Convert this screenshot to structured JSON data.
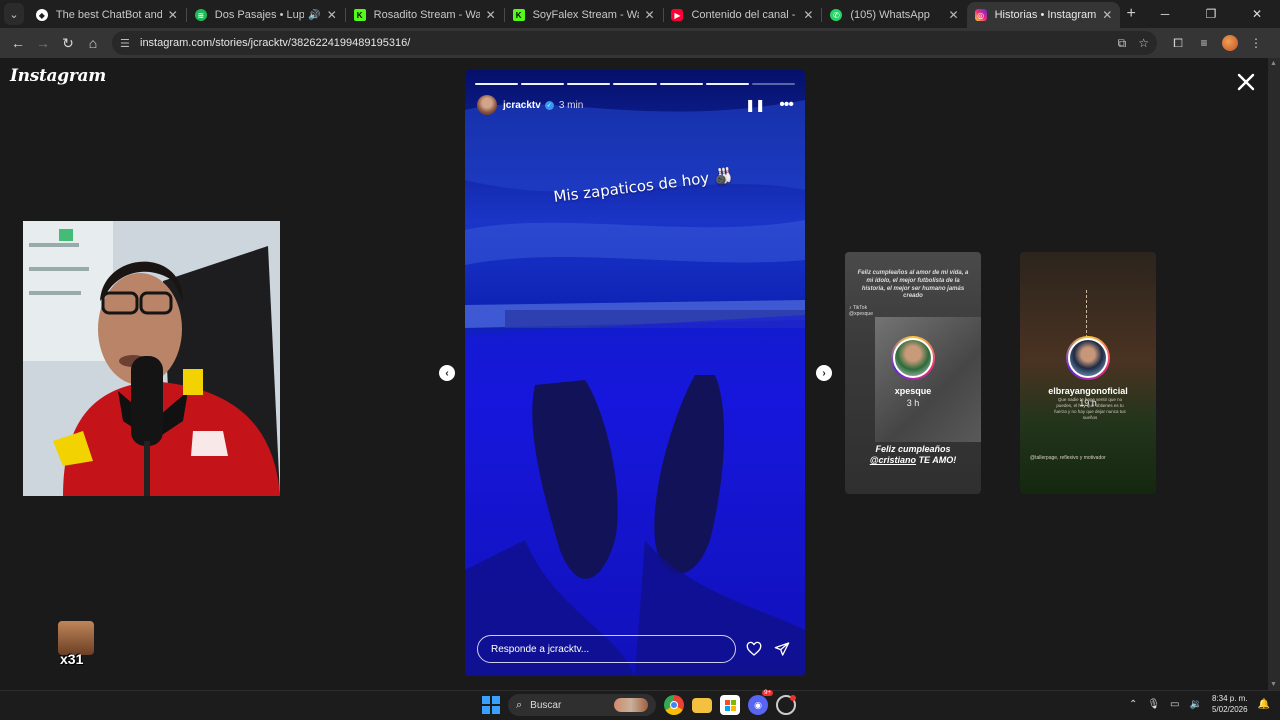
{
  "browser": {
    "tabs": [
      {
        "title": "The best ChatBot and Widgets",
        "favicon": "chatbot-icon",
        "color": "#ffffff",
        "active": false
      },
      {
        "title": "Dos Pasajes • Lupe Y Polo",
        "favicon": "spotify-icon",
        "color": "#1db954",
        "active": false,
        "audio": true
      },
      {
        "title": "Rosadito Stream - Watch Live o",
        "favicon": "kick-icon",
        "color": "#53fc18",
        "active": false
      },
      {
        "title": "SoyFalex Stream - Watch Live o",
        "favicon": "kick-icon",
        "color": "#53fc18",
        "active": false
      },
      {
        "title": "Contenido del canal - YouTube",
        "favicon": "youtube-icon",
        "color": "#ff0033",
        "active": false
      },
      {
        "title": "(105) WhatsApp",
        "favicon": "whatsapp-icon",
        "color": "#25d366",
        "active": false
      },
      {
        "title": "Historias • Instagram",
        "favicon": "instagram-icon",
        "color": "#e1306c",
        "active": true
      }
    ],
    "new_tab_label": "+",
    "url": "instagram.com/stories/jcracktv/3826224199489195316/"
  },
  "instagram": {
    "logo": "Instagram",
    "story": {
      "username": "jcracktv",
      "time": "3 min",
      "caption": "Mis zapaticos de hoy 🎳",
      "reply_placeholder": "Responde a jcracktv...",
      "segments_total": 7,
      "segments_done": 6
    },
    "next_stories": [
      {
        "username": "xpesque",
        "time": "3 h",
        "quote": "Feliz cumpleaños al amor de mi vida, a mi ídolo, el mejor futbolista de la historia, el mejor ser humano jamás creado",
        "watermark": "TikTok",
        "watermark_handle": "@xpesque",
        "bottom_line1": "Feliz cumpleaños",
        "bottom_mention": "@cristiano",
        "bottom_line2_rest": "TE AMO!"
      },
      {
        "username": "elbrayangonoficial",
        "time": "19 h",
        "small_text": "Que nadie te haga sentir que no puedes, el hoy que obtienes es tu fuerza y no hay que dejar nunca tus sueños",
        "tagline": "@tallerpage, reflexivo y motivador"
      }
    ]
  },
  "overlay": {
    "gift_count": "x31"
  },
  "taskbar": {
    "search_label": "Buscar",
    "time": "8:34 p. m.",
    "date": "5/02/2026",
    "discord_badge": "9+"
  }
}
